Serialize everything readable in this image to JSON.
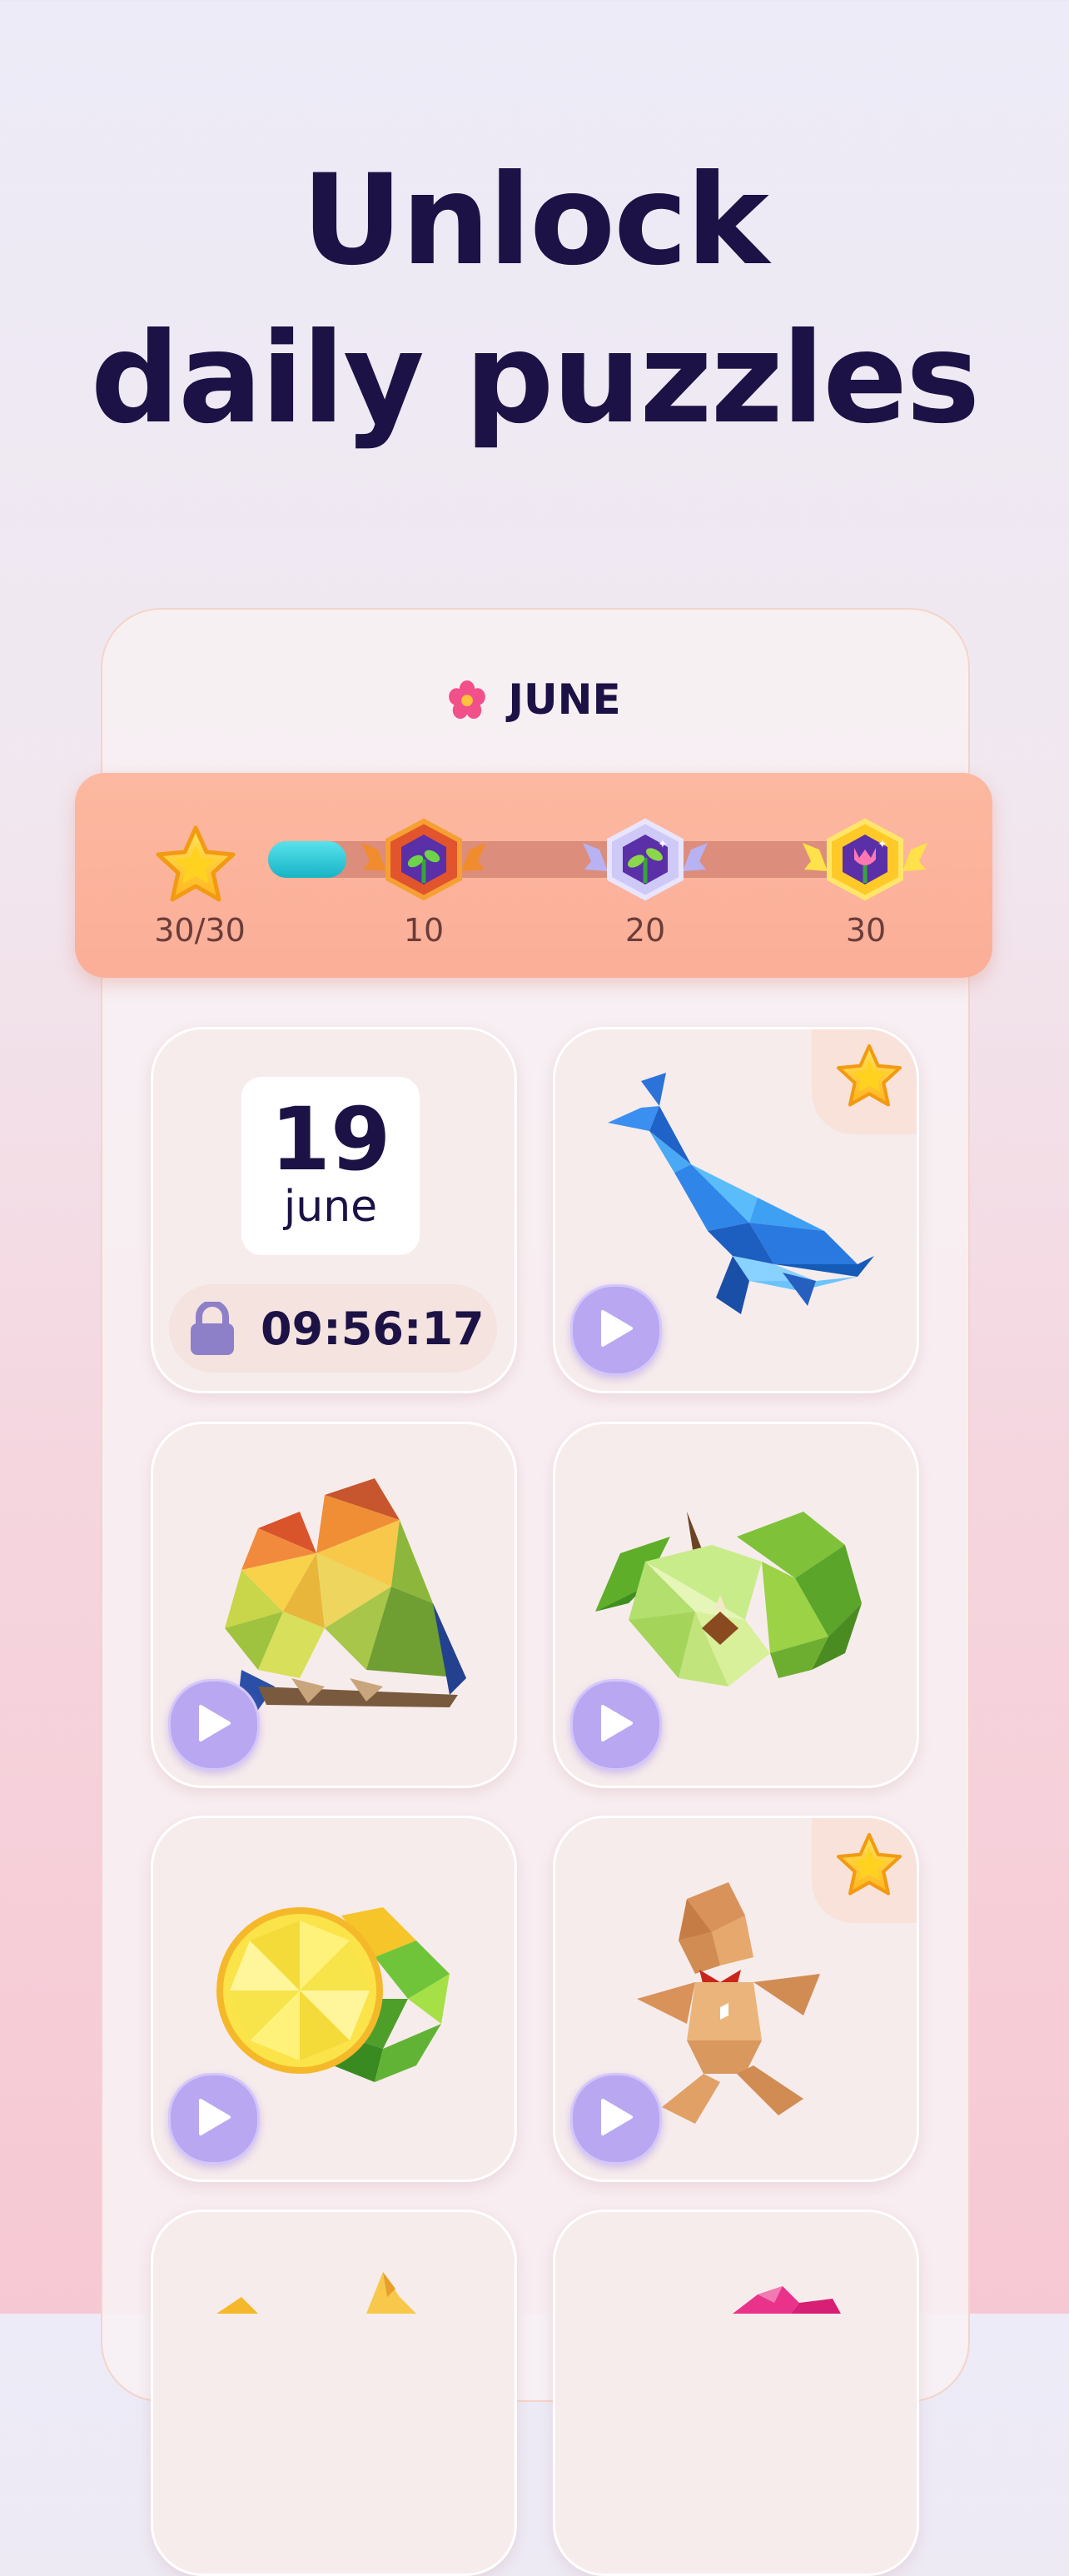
{
  "headline": {
    "line1": "Unlock",
    "line2": "daily puzzles"
  },
  "calendar": {
    "month": "JUNE",
    "progress": {
      "stars_label": "30/30",
      "fill_fraction": 0.13,
      "milestones": [
        {
          "label": "10",
          "icon": "sprout-badge-icon"
        },
        {
          "label": "20",
          "icon": "sprout-badge-icon"
        },
        {
          "label": "30",
          "icon": "tulip-badge-icon"
        }
      ]
    },
    "locked_day": {
      "day": "19",
      "month": "june",
      "countdown": "09:56:17"
    },
    "puzzles": [
      {
        "name": "whale",
        "starred": true
      },
      {
        "name": "lovebirds",
        "starred": false
      },
      {
        "name": "apples",
        "starred": false
      },
      {
        "name": "lemon",
        "starred": false
      },
      {
        "name": "gingerbread",
        "starred": true
      }
    ]
  },
  "colors": {
    "title": "#1c1245",
    "accent": "#b9a7f2",
    "progress_fill": "#16b4c6",
    "progress_card": "#fbae98"
  }
}
